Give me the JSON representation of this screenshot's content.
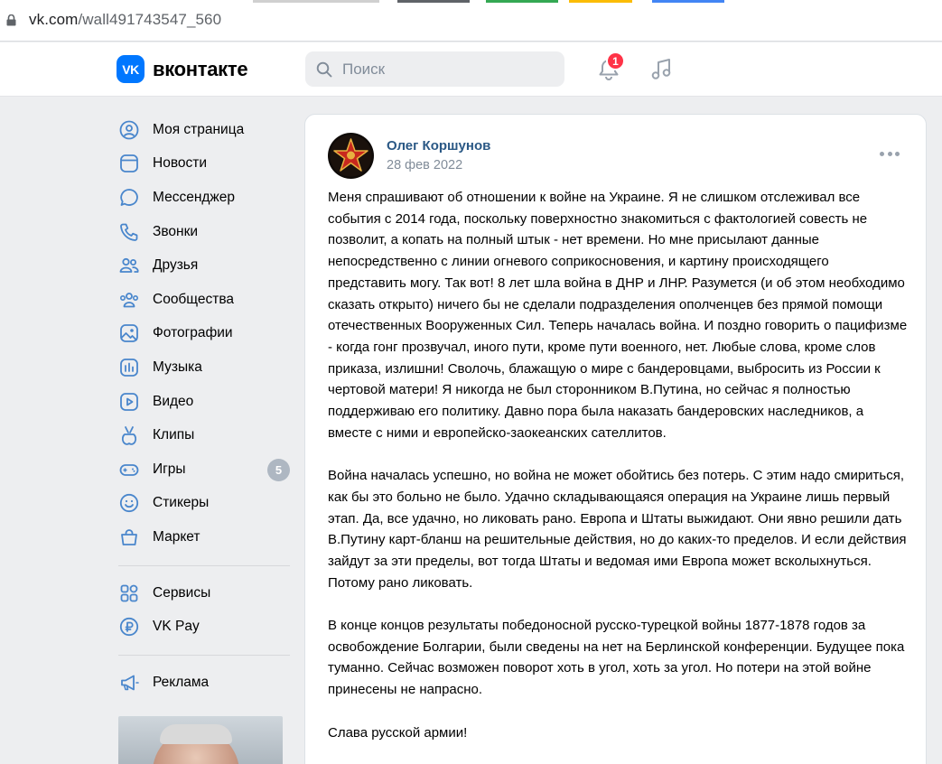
{
  "browser": {
    "url_host": "vk.com",
    "url_path": "/wall491743547_560"
  },
  "header": {
    "logo_mark": "VK",
    "logo_text": "вконтакте",
    "search_placeholder": "Поиск",
    "notification_count": "1"
  },
  "sidebar": {
    "items": [
      {
        "label": "Моя страница",
        "icon": "user-circle-icon"
      },
      {
        "label": "Новости",
        "icon": "news-icon"
      },
      {
        "label": "Мессенджер",
        "icon": "message-bubble-icon"
      },
      {
        "label": "Звонки",
        "icon": "phone-icon"
      },
      {
        "label": "Друзья",
        "icon": "friends-icon"
      },
      {
        "label": "Сообщества",
        "icon": "communities-icon"
      },
      {
        "label": "Фотографии",
        "icon": "photo-icon"
      },
      {
        "label": "Музыка",
        "icon": "music-bars-icon"
      },
      {
        "label": "Видео",
        "icon": "video-icon"
      },
      {
        "label": "Клипы",
        "icon": "clips-icon"
      },
      {
        "label": "Игры",
        "icon": "gamepad-icon",
        "count": "5"
      },
      {
        "label": "Стикеры",
        "icon": "smile-icon"
      },
      {
        "label": "Маркет",
        "icon": "market-bag-icon"
      }
    ],
    "services": [
      {
        "label": "Сервисы",
        "icon": "services-grid-icon"
      },
      {
        "label": "VK Pay",
        "icon": "ruble-icon"
      }
    ],
    "ads": [
      {
        "label": "Реклама",
        "icon": "megaphone-icon"
      }
    ]
  },
  "post": {
    "author": "Олег Коршунов",
    "date": "28 фев 2022",
    "paragraphs": [
      "Меня спрашивают об отношении к войне на Украине. Я не слишком отслеживал все события с 2014 года, поскольку поверхностно знакомиться с фактологией совесть не позволит, а копать на полный штык - нет времени. Но мне присылают данные непосредственно с линии огневого соприкосновения, и картину происходящего представить могу. Так вот! 8 лет шла война в ДНР и ЛНР. Разумется (и об этом необходимо сказать открыто) ничего бы не сделали подразделения ополченцев без прямой помощи отечественных Вооруженных Сил. Теперь началась война. И поздно говорить о пацифизме - когда гонг прозвучал, иного пути, кроме пути военного, нет. Любые слова, кроме слов приказа, излишни! Сволочь, блажащую о мире с бандеровцами, выбросить из России к чертовой матери! Я никогда не был сторонником В.Путина, но сейчас я полностью поддерживаю его политику. Давно пора была наказать бандеровских наследников, а вместе с ними и европейско-заокеанских сателлитов.",
      "Война началась успешно, но война не может обойтись без потерь. С этим надо смириться, как бы это больно не было. Удачно складывающаяся операция на Украине лишь первый этап. Да, все удачно, но ликовать рано. Европа и Штаты выжидают. Они явно решили дать В.Путину карт-бланш на решительные действия, но до каких-то пределов. И если действия зайдут за эти пределы, вот тогда Штаты и ведомая ими Европа может всколыхнуться. Потому рано ликовать.",
      "В конце концов результаты победоносной русско-турецкой войны 1877-1878 годов за освобождение Болгарии, были сведены на нет на Берлинской конференции. Будущее пока туманно. Сейчас возможен поворот хоть в угол, хоть за угол. Но потери на этой войне принесены не напрасно.",
      "Слава русской армии!"
    ]
  },
  "colors": {
    "accent": "#0077ff",
    "link": "#2a5885",
    "muted": "#818c99",
    "icon": "#4986cc",
    "badge": "#ff3347"
  }
}
